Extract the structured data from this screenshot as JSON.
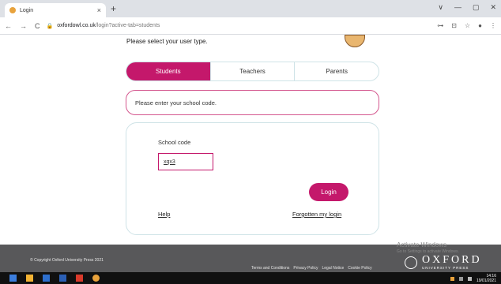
{
  "browser": {
    "tab_title": "Login",
    "tab_close": "×",
    "new_tab": "+",
    "window_controls": [
      "∨",
      "—",
      "▢",
      "✕"
    ],
    "nav": {
      "back": "←",
      "forward": "→",
      "reload": "C"
    },
    "url_host": "oxfordowl.co.uk",
    "url_path": "/login?active-tab=students",
    "url_lock": "🔒",
    "addr_icons": [
      "⊶",
      "⊡",
      "☆",
      "●",
      "⋮"
    ]
  },
  "page": {
    "user_type_prompt": "Please select your user type.",
    "tabs": [
      {
        "label": "Students",
        "active": true
      },
      {
        "label": "Teachers",
        "active": false
      },
      {
        "label": "Parents",
        "active": false
      }
    ],
    "message": "Please enter your school code.",
    "form": {
      "school_code_label": "School code",
      "school_code_value": "xqx3",
      "login_label": "Login",
      "help_label": "Help",
      "forgotten_label": "Forgotten my login"
    }
  },
  "footer": {
    "copyright": "© Copyright Oxford University Press 2021",
    "links": [
      "Terms and Conditions",
      "Privacy Policy",
      "Legal Notice",
      "Cookie Policy"
    ],
    "logo_text": "OXFORD",
    "logo_sub": "UNIVERSITY PRESS",
    "activate_title": "Activate Windows",
    "activate_sub": "Go to Settings to activate Windows."
  },
  "taskbar": {
    "icons": [
      {
        "name": "windows-start-icon",
        "color": "#3b7ddd"
      },
      {
        "name": "file-explorer-icon",
        "color": "#f2b233"
      },
      {
        "name": "store-icon",
        "color": "#2d6fce"
      },
      {
        "name": "word-icon",
        "color": "#2b5fb5"
      },
      {
        "name": "acrobat-icon",
        "color": "#d93a2b"
      },
      {
        "name": "chrome-icon",
        "color": "#e9a23b"
      }
    ],
    "time": "14:16",
    "date": "19/01/2021"
  },
  "colors": {
    "accent": "#c4186b",
    "border": "#cfe3e7",
    "footer_bg": "#58585a"
  }
}
